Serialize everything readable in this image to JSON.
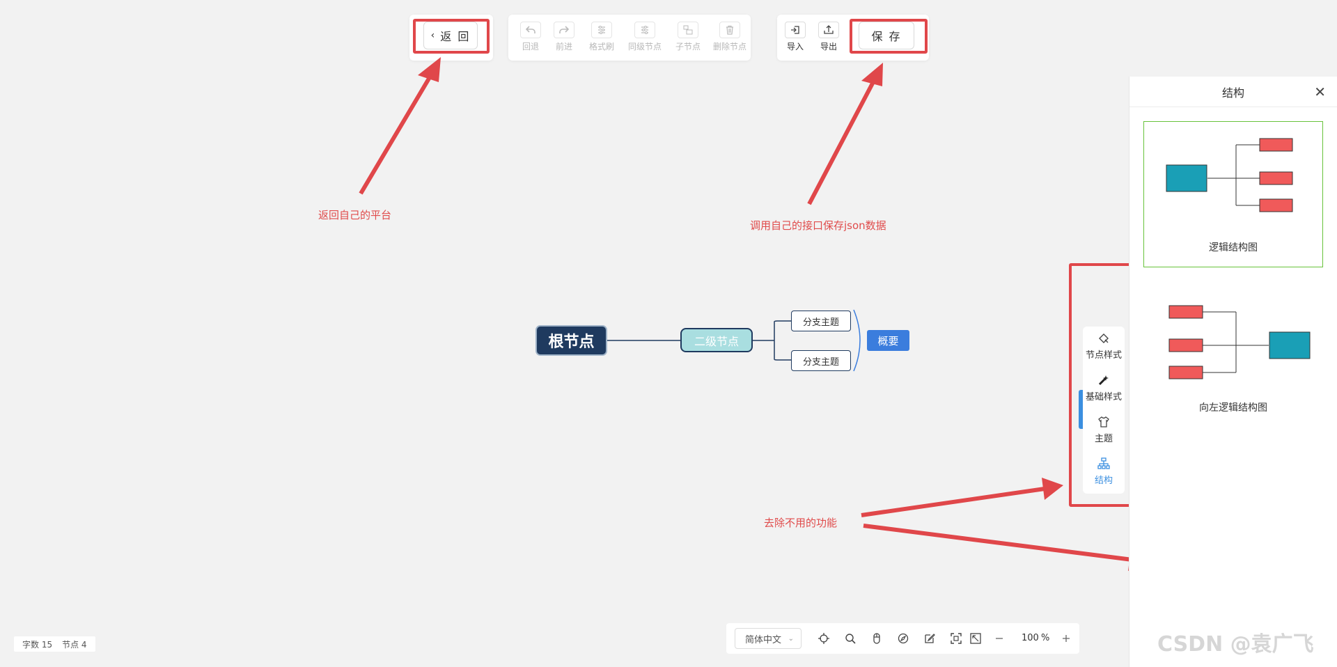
{
  "toolbar": {
    "back_label": "返 回",
    "save_label": "保 存",
    "tools": [
      {
        "label": "回退",
        "icon": "undo-icon",
        "enabled": false
      },
      {
        "label": "前进",
        "icon": "redo-icon",
        "enabled": false
      },
      {
        "label": "格式刷",
        "icon": "format-brush-icon",
        "enabled": false
      },
      {
        "label": "同级节点",
        "icon": "sibling-node-icon",
        "enabled": false
      },
      {
        "label": "子节点",
        "icon": "child-node-icon",
        "enabled": false
      },
      {
        "label": "删除节点",
        "icon": "delete-node-icon",
        "enabled": false
      }
    ],
    "io": [
      {
        "label": "导入",
        "icon": "import-icon"
      },
      {
        "label": "导出",
        "icon": "export-icon"
      }
    ]
  },
  "annotations": {
    "back": "返回自己的平台",
    "save": "调用自己的接口保存json数据",
    "remove": "去除不用的功能",
    "accent_color": "#e0474a"
  },
  "mindmap": {
    "root": "根节点",
    "second": "二级节点",
    "branches": [
      "分支主题",
      "分支主题"
    ],
    "summary": "概要"
  },
  "side_tabs": [
    {
      "label": "节点样式",
      "icon": "node-style-icon",
      "active": false
    },
    {
      "label": "基础样式",
      "icon": "base-style-icon",
      "active": false
    },
    {
      "label": "主题",
      "icon": "theme-shirt-icon",
      "active": false
    },
    {
      "label": "结构",
      "icon": "structure-icon",
      "active": true
    }
  ],
  "right_panel": {
    "title": "结构",
    "layouts": [
      {
        "label": "逻辑结构图",
        "selected": true
      },
      {
        "label": "向左逻辑结构图",
        "selected": false
      }
    ]
  },
  "status": {
    "word_count": "字数 15",
    "node_count": "节点 4"
  },
  "bottom_bar": {
    "language": "简体中文",
    "zoom": "100",
    "zoom_unit": "%"
  },
  "watermark": "CSDN @袁广飞"
}
